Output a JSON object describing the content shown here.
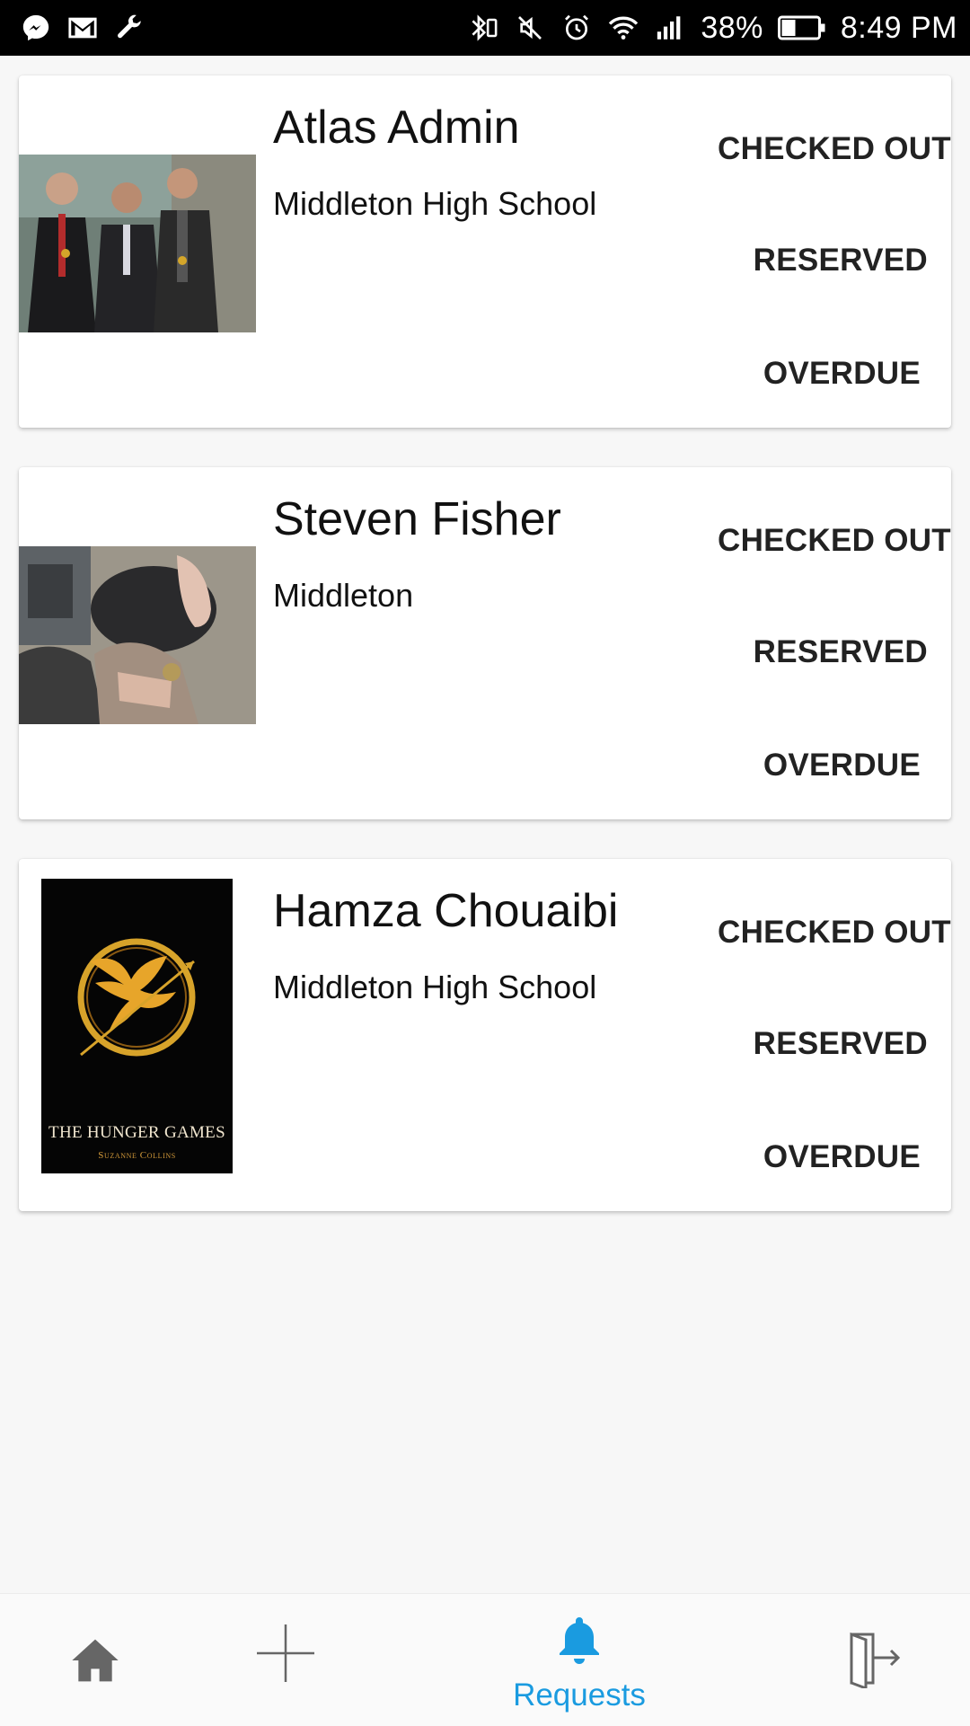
{
  "status_bar": {
    "battery": "38%",
    "time": "8:49 PM",
    "icons_left": [
      "messenger-icon",
      "gmail-icon",
      "wrench-icon"
    ],
    "icons_right": [
      "bluetooth-icon",
      "mute-icon",
      "alarm-icon",
      "wifi-icon",
      "signal-icon",
      "battery-icon"
    ]
  },
  "requests": [
    {
      "name": "Atlas Admin",
      "school": "Middleton High School",
      "image": "group-photo",
      "actions": [
        "CHECKED OUT",
        "RESERVED",
        "OVERDUE"
      ]
    },
    {
      "name": "Steven Fisher",
      "school": "Middleton",
      "image": "pet-photo",
      "actions": [
        "CHECKED OUT",
        "RESERVED",
        "OVERDUE"
      ]
    },
    {
      "name": "Hamza Chouaibi",
      "school": "Middleton High School",
      "image": "book-cover",
      "book_title": "THE HUNGER GAMES",
      "book_author": "Suzanne Collins",
      "actions": [
        "CHECKED OUT",
        "RESERVED",
        "OVERDUE"
      ]
    }
  ],
  "bottom_nav": {
    "items": [
      {
        "icon": "home-icon",
        "label": ""
      },
      {
        "icon": "plus-icon",
        "label": ""
      },
      {
        "icon": "bell-icon",
        "label": "Requests",
        "active": true
      },
      {
        "icon": "logout-icon",
        "label": ""
      }
    ]
  },
  "colors": {
    "accent": "#1a9be0",
    "nav_inactive": "#666666",
    "background": "#f7f7f7",
    "status_bar": "#000000"
  }
}
